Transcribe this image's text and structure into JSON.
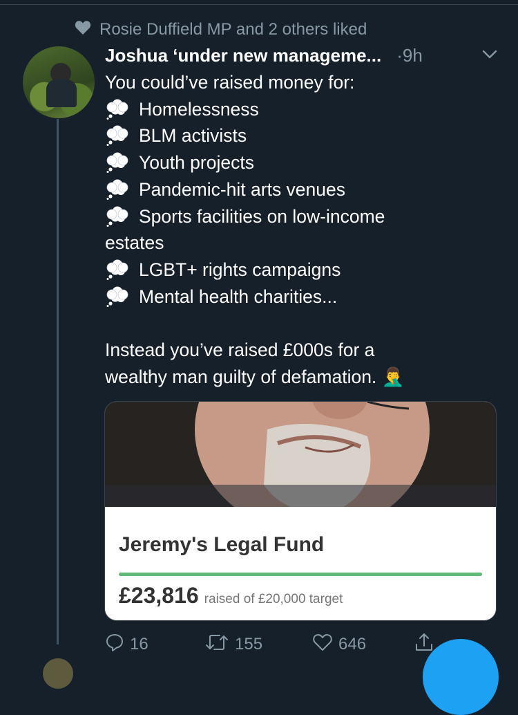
{
  "social_context": {
    "text": "Rosie Duffield MP and 2 others liked",
    "icon": "heart-icon"
  },
  "tweet": {
    "author": "Joshua ‘under new manageme...",
    "time": "·9h",
    "intro": "You could’ve raised money for:",
    "bullets": [
      "Homelessness",
      "BLM activists",
      "Youth projects",
      "Pandemic-hit arts venues",
      "Sports facilities on low-income",
      "LGBT+ rights campaigns",
      "Mental health charities..."
    ],
    "bullet_continuation": "estates",
    "closing_line1": "Instead you’ve raised £000s for a",
    "closing_line2": "wealthy man guilty of defamation.",
    "closing_emoji": "🤦‍♂️",
    "bullet_icon": "thought-balloon-icon"
  },
  "card": {
    "title": "Jeremy's Legal Fund",
    "raised_amount": "£23,816",
    "raised_text": "raised of £20,000 target",
    "progress_percent": 100,
    "progress_color": "#61b97a"
  },
  "actions": {
    "replies": "16",
    "retweets": "155",
    "likes": "646"
  },
  "colors": {
    "background": "#15202b",
    "secondary_text": "#8899a6",
    "accent": "#1da1f2"
  }
}
